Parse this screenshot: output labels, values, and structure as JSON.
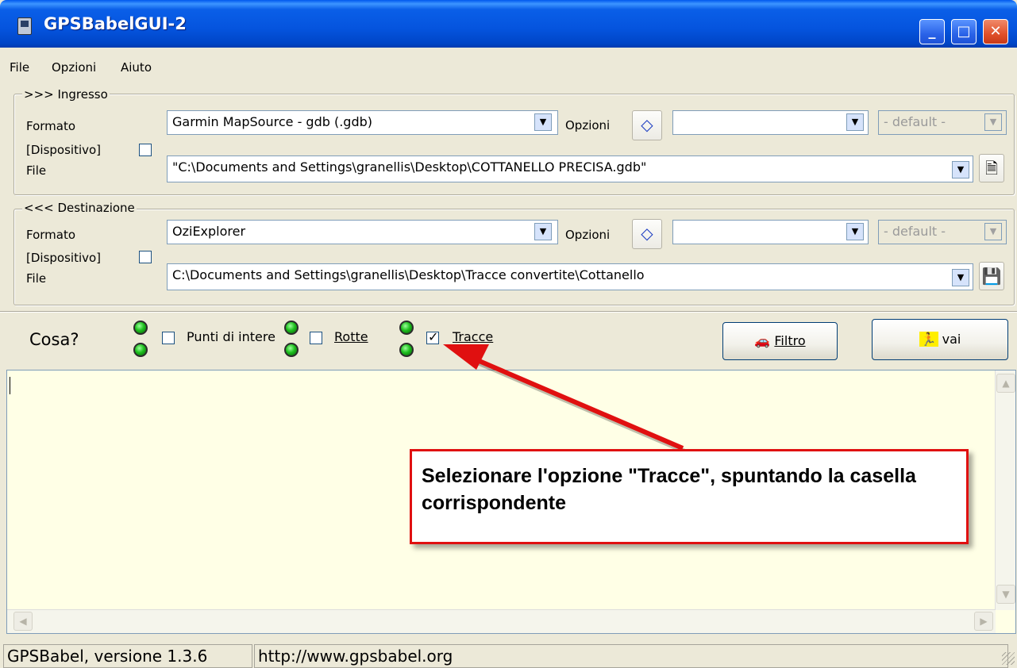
{
  "window": {
    "title": "GPSBabelGUI-2"
  },
  "menu": [
    "File",
    "Opzioni",
    "Aiuto"
  ],
  "input": {
    "legend": ">>> Ingresso",
    "format_label": "Formato",
    "device_label": "[Dispositivo]",
    "file_label": "File",
    "format_value": "Garmin MapSource - gdb (.gdb)",
    "options_label": "Opzioni",
    "options_value": "",
    "default_value": "- default -",
    "file_value": "\"C:\\Documents and Settings\\granellis\\Desktop\\COTTANELLO PRECISA.gdb\"",
    "device_checked": false
  },
  "output_group": {
    "legend": "<<< Destinazione",
    "format_label": "Formato",
    "device_label": "[Dispositivo]",
    "file_label": "File",
    "format_value": "OziExplorer",
    "options_label": "Opzioni",
    "options_value": "",
    "default_value": "- default -",
    "file_value": "C:\\Documents and Settings\\granellis\\Desktop\\Tracce convertite\\Cottanello",
    "device_checked": false
  },
  "what": {
    "label": "Cosa?",
    "waypoints": {
      "label": "Punti di intere",
      "checked": false
    },
    "routes": {
      "label": "Rotte",
      "checked": false
    },
    "tracks": {
      "label": "Tracce",
      "checked": true
    },
    "filter_button": "Filtro",
    "go_button": "vai"
  },
  "annotation": {
    "text": "Selezionare l'opzione \"Tracce\", spuntando la casella corrispondente",
    "color": "#e01010"
  },
  "status": {
    "version": "GPSBabel, versione 1.3.6",
    "url": "http://www.gpsbabel.org"
  },
  "icons": [
    "gps-app-icon",
    "minimize-icon",
    "maximize-icon",
    "close-icon",
    "eraser-options-icon",
    "open-file-icon",
    "save-file-icon",
    "led-icon",
    "filter-car-icon",
    "run-icon"
  ]
}
